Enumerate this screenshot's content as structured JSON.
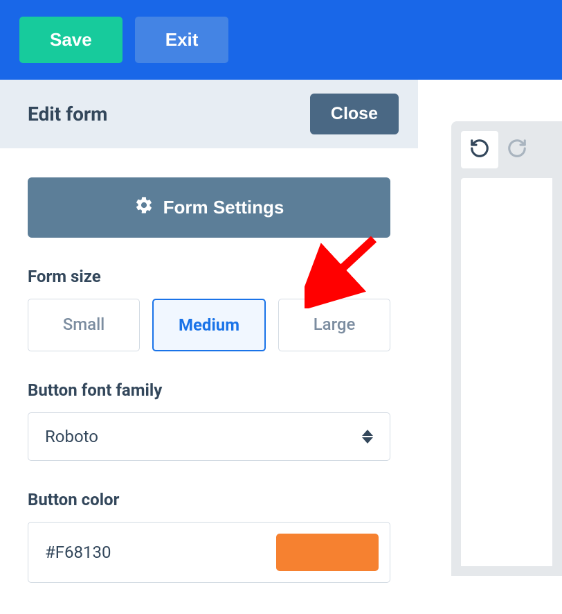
{
  "topbar": {
    "save_label": "Save",
    "exit_label": "Exit"
  },
  "panel": {
    "title": "Edit form",
    "close_label": "Close",
    "settings_label": "Form Settings"
  },
  "form_size": {
    "label": "Form size",
    "options": [
      "Small",
      "Medium",
      "Large"
    ],
    "selected": "Medium"
  },
  "font_family": {
    "label": "Button font family",
    "value": "Roboto"
  },
  "button_color": {
    "label": "Button color",
    "value": "#F68130",
    "swatch": "#F68130"
  },
  "annotation": {
    "arrow_color": "#ff0000"
  }
}
